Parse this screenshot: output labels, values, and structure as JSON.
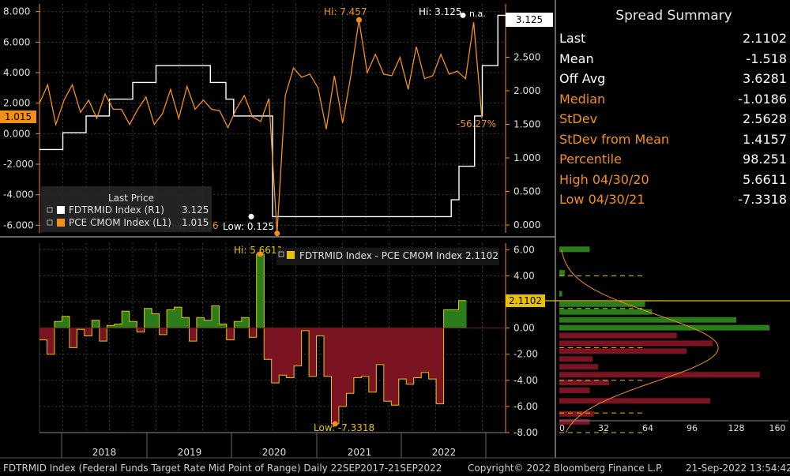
{
  "top_chart": {
    "last_price_title": "Last Price",
    "legend": [
      {
        "name": "FDTRMID Index  (R1)",
        "value": "3.125",
        "color": "#ffffff"
      },
      {
        "name": "PCE CMOM Index  (L1)",
        "value": "1.015",
        "color": "#f39019"
      }
    ],
    "left_ticks": [
      "8.000",
      "6.000",
      "4.000",
      "2.000",
      "0.000",
      "-2.000",
      "-4.000",
      "-6.000"
    ],
    "right_ticks": [
      "3.000",
      "2.500",
      "2.000",
      "1.500",
      "1.000",
      "0.500",
      "0.000"
    ],
    "left_badge": "1.015",
    "right_badge": "3.125",
    "annotations": {
      "hi_orange": "Hi: 7.457",
      "hi_white": "Hi: 3.125",
      "na": "n.a.",
      "low_white": "Low: 0.125",
      "low_orange": "Low: -6.536",
      "pct": "-56.27%"
    }
  },
  "bottom_chart": {
    "legend": "FDTRMID Index - PCE CMOM Index 2.1102",
    "right_ticks": [
      "6.00",
      "4.00",
      "2.00",
      "0.00",
      "-2.00",
      "-4.00",
      "-6.00",
      "-8.00"
    ],
    "badge": "2.1102",
    "hi": "Hi: 5.6611",
    "low": "Low: -7.3318",
    "hist_ticks": [
      "0",
      "32",
      "64",
      "96",
      "128",
      "160"
    ]
  },
  "x_years": [
    "2018",
    "2019",
    "2020",
    "2021",
    "2022"
  ],
  "summary": {
    "title": "Spread Summary",
    "rows": [
      {
        "label": "Last",
        "value": "2.1102",
        "color": "#ffffff"
      },
      {
        "label": "Mean",
        "value": "-1.518",
        "color": "#ffffff"
      },
      {
        "label": "Off Avg",
        "value": "3.6281",
        "color": "#ffffff"
      },
      {
        "label": "Median",
        "value": "-1.0186",
        "color": "#f39019"
      },
      {
        "label": "StDev",
        "value": "2.5628",
        "color": "#f39019"
      },
      {
        "label": "StDev from Mean",
        "value": "1.4157",
        "color": "#f39019"
      },
      {
        "label": "Percentile",
        "value": "98.251",
        "color": "#f39019"
      },
      {
        "label": "High 04/30/20",
        "value": "5.6611",
        "color": "#f39019"
      },
      {
        "label": "Low 04/30/21",
        "value": "-7.3318",
        "color": "#f39019"
      }
    ]
  },
  "footer": {
    "left": "FDTRMID Index (Federal Funds Target Rate Mid Point of Range)  Daily 22SEP2017-21SEP2022",
    "center": "Copyright© 2022 Bloomberg Finance L.P.",
    "right": "21-Sep-2022 13:54:42"
  },
  "chart_data": [
    {
      "type": "line",
      "x": [
        "2017-09",
        "2017-10",
        "2017-11",
        "2017-12",
        "2018-01",
        "2018-02",
        "2018-03",
        "2018-04",
        "2018-05",
        "2018-06",
        "2018-07",
        "2018-08",
        "2018-09",
        "2018-10",
        "2018-11",
        "2018-12",
        "2019-01",
        "2019-02",
        "2019-03",
        "2019-04",
        "2019-05",
        "2019-06",
        "2019-07",
        "2019-08",
        "2019-09",
        "2019-10",
        "2019-11",
        "2019-12",
        "2020-01",
        "2020-02",
        "2020-03",
        "2020-04",
        "2020-05",
        "2020-06",
        "2020-07",
        "2020-08",
        "2020-09",
        "2020-10",
        "2020-11",
        "2020-12",
        "2021-01",
        "2021-02",
        "2021-03",
        "2021-04",
        "2021-05",
        "2021-06",
        "2021-07",
        "2021-08",
        "2021-09",
        "2021-10",
        "2021-11",
        "2021-12",
        "2022-01",
        "2022-02",
        "2022-03",
        "2022-04",
        "2022-05",
        "2022-06",
        "2022-07",
        "2022-08"
      ],
      "series": [
        {
          "name": "FDTRMID Index (R1)",
          "axis": "right",
          "values": [
            1.125,
            1.125,
            1.125,
            1.375,
            1.375,
            1.375,
            1.625,
            1.625,
            1.625,
            1.875,
            1.875,
            1.875,
            2.125,
            2.125,
            2.125,
            2.375,
            2.375,
            2.375,
            2.375,
            2.375,
            2.375,
            2.375,
            2.125,
            2.125,
            1.875,
            1.625,
            1.625,
            1.625,
            1.625,
            1.625,
            0.125,
            0.125,
            0.125,
            0.125,
            0.125,
            0.125,
            0.125,
            0.125,
            0.125,
            0.125,
            0.125,
            0.125,
            0.125,
            0.125,
            0.125,
            0.125,
            0.125,
            0.125,
            0.125,
            0.125,
            0.125,
            0.125,
            0.125,
            0.375,
            0.875,
            0.875,
            1.625,
            2.375,
            2.375,
            3.125
          ]
        },
        {
          "name": "PCE CMOM Index (L1)",
          "axis": "left",
          "values": [
            2.0,
            3.2,
            0.6,
            2.2,
            3.2,
            1.4,
            2.2,
            1.0,
            2.6,
            1.6,
            1.6,
            0.6,
            1.6,
            2.4,
            0.6,
            1.3,
            2.9,
            1.0,
            3.1,
            1.6,
            2.2,
            1.6,
            1.5,
            0.4,
            1.6,
            2.5,
            1.1,
            0.8,
            2.3,
            -6.536,
            2.5,
            4.3,
            3.7,
            3.9,
            3.0,
            0.3,
            3.8,
            0.7,
            3.8,
            7.457,
            4.0,
            5.2,
            3.9,
            3.8,
            5.0,
            2.9,
            5.7,
            3.6,
            3.8,
            5.2,
            3.9,
            4.1,
            3.6,
            7.3,
            1.015
          ]
        }
      ],
      "left_ylim": [
        -6.5,
        8.5
      ],
      "right_ylim": [
        0,
        3.3
      ],
      "legend": "inside-bottom-left"
    },
    {
      "type": "area",
      "name": "FDTRMID Index - PCE CMOM Index",
      "x": [
        "2017-09",
        "2017-10",
        "2017-11",
        "2017-12",
        "2018-01",
        "2018-02",
        "2018-03",
        "2018-04",
        "2018-05",
        "2018-06",
        "2018-07",
        "2018-08",
        "2018-09",
        "2018-10",
        "2018-11",
        "2018-12",
        "2019-01",
        "2019-02",
        "2019-03",
        "2019-04",
        "2019-05",
        "2019-06",
        "2019-07",
        "2019-08",
        "2019-09",
        "2019-10",
        "2019-11",
        "2019-12",
        "2020-01",
        "2020-02",
        "2020-03",
        "2020-04",
        "2020-05",
        "2020-06",
        "2020-07",
        "2020-08",
        "2020-09",
        "2020-10",
        "2020-11",
        "2020-12",
        "2021-01",
        "2021-02",
        "2021-03",
        "2021-04",
        "2021-05",
        "2021-06",
        "2021-07",
        "2021-08",
        "2021-09",
        "2021-10",
        "2021-11",
        "2021-12",
        "2022-01",
        "2022-02",
        "2022-03",
        "2022-04",
        "2022-05",
        "2022-06",
        "2022-07",
        "2022-08"
      ],
      "values": [
        -0.9,
        -2.0,
        0.5,
        0.9,
        -1.5,
        -0.1,
        -0.6,
        0.6,
        -1.0,
        0.2,
        0.3,
        1.3,
        0.5,
        -0.3,
        1.5,
        1.1,
        -0.5,
        1.4,
        1.6,
        0.8,
        -1.0,
        0.8,
        0.6,
        1.7,
        0.3,
        -0.9,
        0.5,
        0.8,
        -0.7,
        5.6611,
        -2.4,
        -4.2,
        -3.6,
        -3.8,
        -2.9,
        -0.2,
        -3.7,
        -0.6,
        -3.7,
        -7.3318,
        -6.0,
        -5.0,
        -3.8,
        -3.7,
        -4.9,
        -2.8,
        -5.6,
        -5.9,
        -3.9,
        -4.3,
        -3.8,
        -3.4,
        -3.9,
        -5.8,
        1.4,
        1.4,
        2.1102
      ],
      "ylim": [
        -8,
        6.5
      ]
    }
  ]
}
